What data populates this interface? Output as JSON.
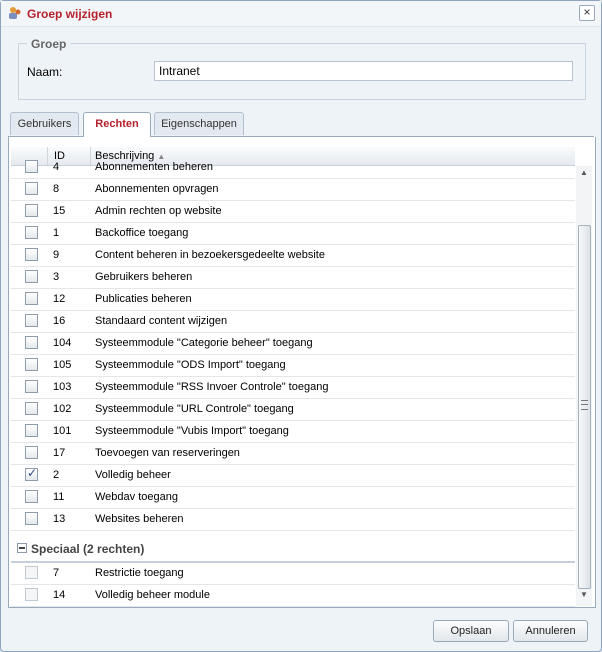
{
  "dialog": {
    "title": "Groep wijzigen"
  },
  "group_section": {
    "legend": "Groep",
    "name_label": "Naam:",
    "name_value": "Intranet"
  },
  "tabs": [
    {
      "label": "Gebruikers",
      "active": false
    },
    {
      "label": "Rechten",
      "active": true
    },
    {
      "label": "Eigenschappen",
      "active": false
    }
  ],
  "grid": {
    "columns": {
      "id": "ID",
      "description": "Beschrijving",
      "sort_indicator": "▲"
    },
    "rows": [
      {
        "id": "4",
        "description": "Abonnementen beheren",
        "checked": false
      },
      {
        "id": "8",
        "description": "Abonnementen opvragen",
        "checked": false
      },
      {
        "id": "15",
        "description": "Admin rechten op website",
        "checked": false
      },
      {
        "id": "1",
        "description": "Backoffice toegang",
        "checked": false
      },
      {
        "id": "9",
        "description": "Content beheren in bezoekersgedeelte website",
        "checked": false
      },
      {
        "id": "3",
        "description": "Gebruikers beheren",
        "checked": false
      },
      {
        "id": "12",
        "description": "Publicaties beheren",
        "checked": false
      },
      {
        "id": "16",
        "description": "Standaard content wijzigen",
        "checked": false
      },
      {
        "id": "104",
        "description": "Systeemmodule \"Categorie beheer\" toegang",
        "checked": false
      },
      {
        "id": "105",
        "description": "Systeemmodule \"ODS Import\" toegang",
        "checked": false
      },
      {
        "id": "103",
        "description": "Systeemmodule \"RSS Invoer Controle\" toegang",
        "checked": false
      },
      {
        "id": "102",
        "description": "Systeemmodule \"URL Controle\" toegang",
        "checked": false
      },
      {
        "id": "101",
        "description": "Systeemmodule \"Vubis Import\" toegang",
        "checked": false
      },
      {
        "id": "17",
        "description": "Toevoegen van reserveringen",
        "checked": false
      },
      {
        "id": "2",
        "description": "Volledig beheer",
        "checked": true
      },
      {
        "id": "11",
        "description": "Webdav toegang",
        "checked": false
      },
      {
        "id": "13",
        "description": "Websites beheren",
        "checked": false
      }
    ],
    "group_special": {
      "label": "Speciaal (2 rechten)",
      "rows": [
        {
          "id": "7",
          "description": "Restrictie toegang",
          "checked": false
        },
        {
          "id": "14",
          "description": "Volledig beheer module",
          "checked": false
        }
      ]
    }
  },
  "buttons": {
    "save": "Opslaan",
    "cancel": "Annuleren"
  }
}
